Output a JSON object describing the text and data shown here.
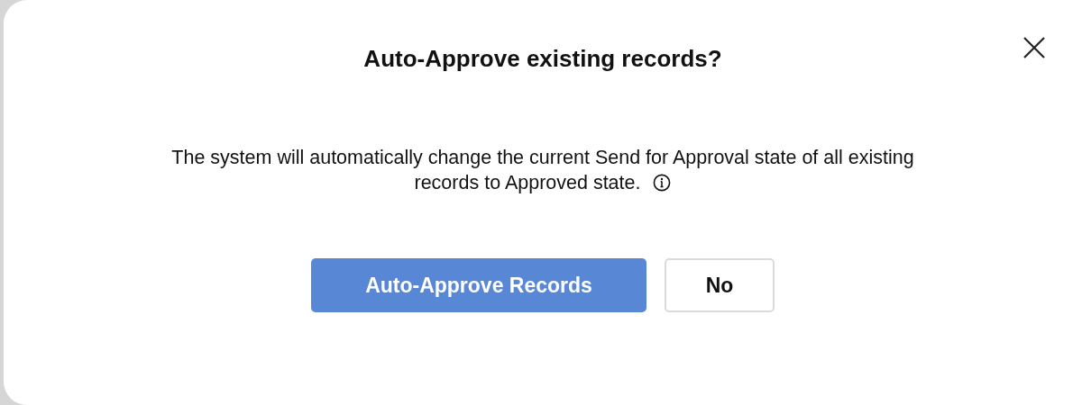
{
  "dialog": {
    "title": "Auto-Approve existing records?",
    "message_lines": [
      "The system will automatically change the current Send for Approval state of all existing",
      "records to Approved state."
    ],
    "buttons": [
      {
        "label": "Auto-Approve Records",
        "kind": "primary"
      },
      {
        "label": "No",
        "kind": "secondary"
      }
    ]
  }
}
